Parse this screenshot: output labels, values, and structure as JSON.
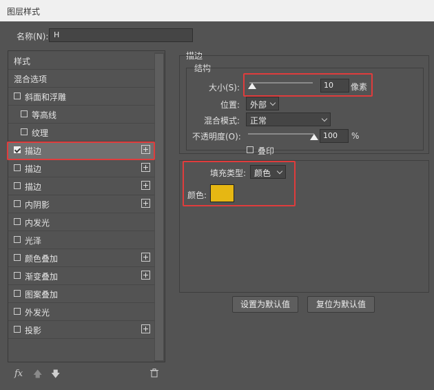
{
  "window": {
    "title": "图层样式"
  },
  "name_field": {
    "label": "名称(N):",
    "value": "H"
  },
  "styles_list": {
    "header": "样式",
    "blend_options": "混合选项",
    "items": [
      {
        "label": "斜面和浮雕",
        "checked": false,
        "plus": false,
        "indent": false
      },
      {
        "label": "等高线",
        "checked": false,
        "plus": false,
        "indent": true
      },
      {
        "label": "纹理",
        "checked": false,
        "plus": false,
        "indent": true
      },
      {
        "label": "描边",
        "checked": true,
        "plus": true,
        "indent": false,
        "active": true
      },
      {
        "label": "描边",
        "checked": false,
        "plus": true,
        "indent": false
      },
      {
        "label": "描边",
        "checked": false,
        "plus": true,
        "indent": false
      },
      {
        "label": "内阴影",
        "checked": false,
        "plus": true,
        "indent": false
      },
      {
        "label": "内发光",
        "checked": false,
        "plus": false,
        "indent": false
      },
      {
        "label": "光泽",
        "checked": false,
        "plus": false,
        "indent": false
      },
      {
        "label": "颜色叠加",
        "checked": false,
        "plus": true,
        "indent": false
      },
      {
        "label": "渐变叠加",
        "checked": false,
        "plus": true,
        "indent": false
      },
      {
        "label": "图案叠加",
        "checked": false,
        "plus": false,
        "indent": false
      },
      {
        "label": "外发光",
        "checked": false,
        "plus": false,
        "indent": false
      },
      {
        "label": "投影",
        "checked": false,
        "plus": true,
        "indent": false
      }
    ]
  },
  "toolbar": {
    "fx_label": "fx",
    "icons": [
      "fx-icon",
      "arrow-up-icon",
      "arrow-down-icon",
      "trash-icon"
    ]
  },
  "stroke": {
    "section_title": "描边",
    "structure_title": "结构",
    "size_label": "大小(S):",
    "size_value": "10",
    "size_unit": "像素",
    "size_fraction": 0.04,
    "position_label": "位置:",
    "position_value": "外部",
    "blend_label": "混合模式:",
    "blend_value": "正常",
    "opacity_label": "不透明度(O):",
    "opacity_value": "100",
    "opacity_unit": "%",
    "opacity_fraction": 1.0,
    "overprint_label": "叠印",
    "fill_type_label": "填充类型:",
    "fill_type_value": "颜色",
    "color_label": "颜色:",
    "color_value": "#e6b713"
  },
  "buttons": {
    "make_default": "设置为默认值",
    "reset_default": "复位为默认值"
  },
  "colors": {
    "highlight_red": "#e03c3c",
    "panel": "#535353"
  }
}
